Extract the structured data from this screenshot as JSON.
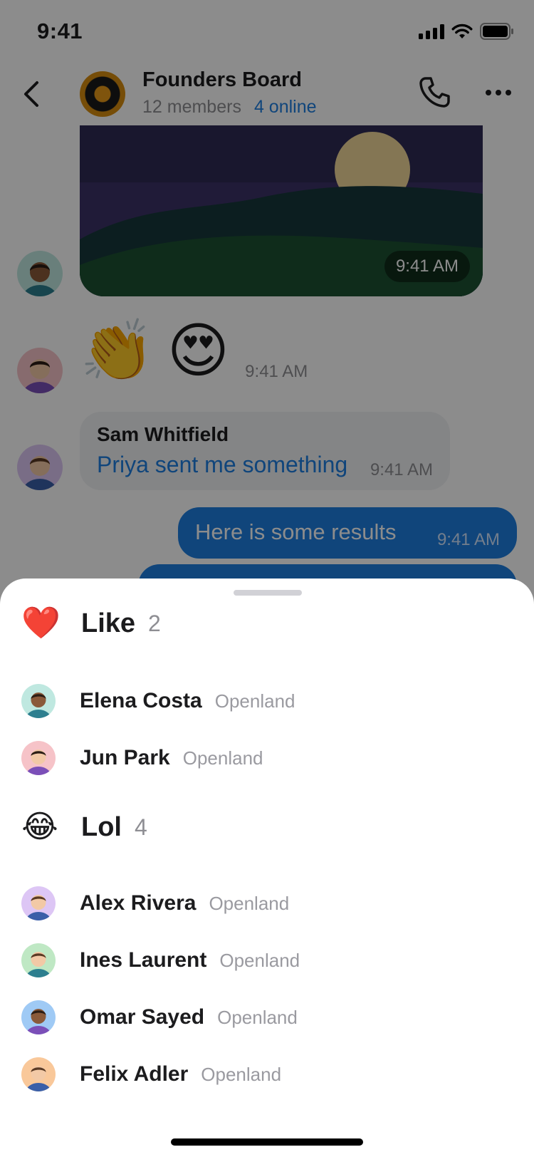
{
  "status_bar": {
    "time": "9:41"
  },
  "chat_header": {
    "title": "Founders Board",
    "members": "12 members",
    "online": "4 online"
  },
  "feed": {
    "photo_time": "9:41 AM",
    "emoji_message": {
      "emojis": [
        "👏",
        "😍"
      ],
      "time": "9:41 AM"
    },
    "incoming": {
      "sender": "Sam Whitfield",
      "text": "Priya sent me something",
      "time": "9:41 AM"
    },
    "outgoing": {
      "text": "Here is some results",
      "time": "9:41 AM"
    }
  },
  "reactions": [
    {
      "emoji": "❤️",
      "icon": "heart-icon",
      "title": "Like",
      "count": "2",
      "users": [
        {
          "name": "Elena Costa",
          "org": "Openland",
          "avatar_bg": "#bfe8e0",
          "skin": "#8a5a3a",
          "shirt": "#2d7f8f"
        },
        {
          "name": "Jun Park",
          "org": "Openland",
          "avatar_bg": "#f6c3c8",
          "skin": "#f2c9a6",
          "shirt": "#7b4fb8"
        }
      ]
    },
    {
      "emoji": "😂",
      "icon": "laughing-icon",
      "title": "Lol",
      "count": "4",
      "users": [
        {
          "name": "Alex Rivera",
          "org": "Openland",
          "avatar_bg": "#ddc6f5",
          "skin": "#f2c9a6",
          "shirt": "#3a5fa8"
        },
        {
          "name": "Ines Laurent",
          "org": "Openland",
          "avatar_bg": "#bfe8c4",
          "skin": "#f2c9a6",
          "shirt": "#2d7f8f"
        },
        {
          "name": "Omar Sayed",
          "org": "Openland",
          "avatar_bg": "#9fcaf5",
          "skin": "#8a5a3a",
          "shirt": "#7b4fb8"
        },
        {
          "name": "Felix Adler",
          "org": "Openland",
          "avatar_bg": "#f9c89a",
          "skin": "#f2c9a6",
          "shirt": "#3a5fa8"
        }
      ]
    }
  ]
}
